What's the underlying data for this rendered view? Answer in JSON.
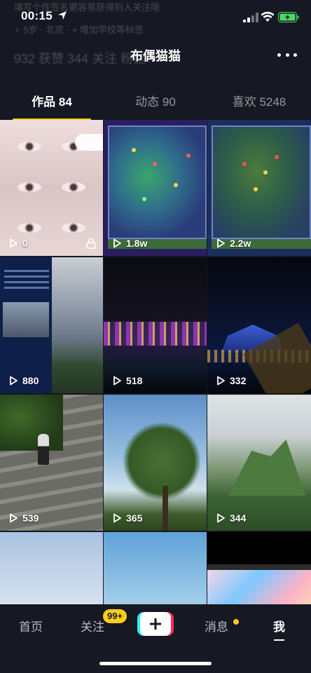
{
  "status_bar": {
    "time": "00:15",
    "battery_color": "#4cd964"
  },
  "header": {
    "title": "布偶猫猫",
    "bg_hint_line1": "填写个性签名更容易获得别人关注哦",
    "bg_hint_line2": "♀ 5岁 · 北京 · + 增加学校等标签",
    "bg_stats": "932 获赞  344 关注  粉丝"
  },
  "tabs": [
    {
      "label": "作品 84",
      "active": true
    },
    {
      "label": "动态 90",
      "active": false
    },
    {
      "label": "喜欢 5248",
      "active": false
    }
  ],
  "videos": [
    {
      "plays": "0",
      "locked": true
    },
    {
      "plays": "1.8w",
      "locked": false
    },
    {
      "plays": "2.2w",
      "locked": false
    },
    {
      "plays": "880",
      "locked": false
    },
    {
      "plays": "518",
      "locked": false
    },
    {
      "plays": "332",
      "locked": false
    },
    {
      "plays": "539",
      "locked": false
    },
    {
      "plays": "365",
      "locked": false
    },
    {
      "plays": "344",
      "locked": false
    },
    {
      "plays": "",
      "locked": false
    },
    {
      "plays": "",
      "locked": false
    },
    {
      "plays": "",
      "locked": false
    }
  ],
  "bottom_nav": {
    "home": "首页",
    "follow": "关注",
    "follow_badge": "99+",
    "messages": "消息",
    "me": "我"
  },
  "colors": {
    "accent_yellow": "#face15",
    "background": "#161823",
    "plus_cyan": "#25f4ee",
    "plus_red": "#fe2c55"
  }
}
